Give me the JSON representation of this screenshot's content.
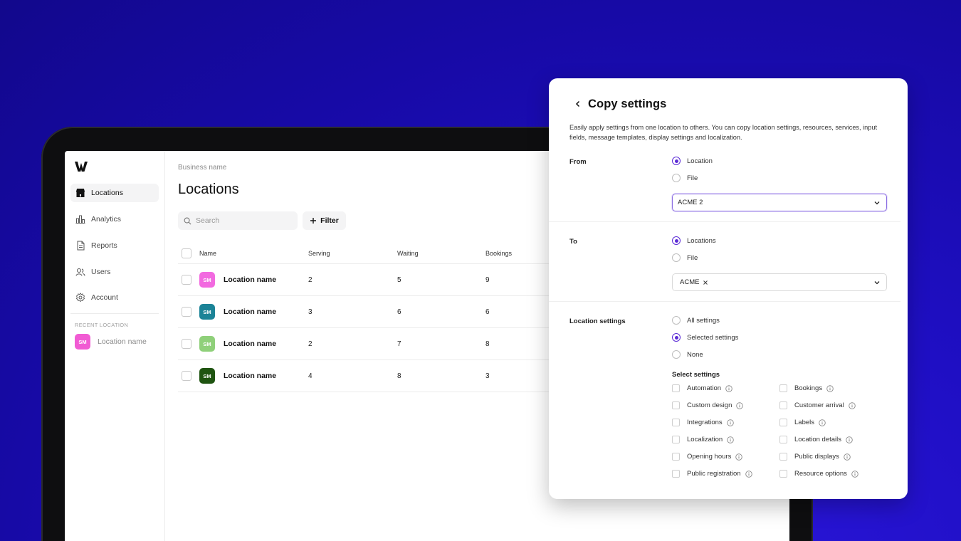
{
  "colors": {
    "accent": "#5b2bd6",
    "background": "#1a0cb3"
  },
  "sidebar": {
    "logo_icon": "logo-w-icon",
    "items": [
      {
        "label": "Locations",
        "icon": "store-icon",
        "active": true
      },
      {
        "label": "Analytics",
        "icon": "chart-icon",
        "active": false
      },
      {
        "label": "Reports",
        "icon": "document-icon",
        "active": false
      },
      {
        "label": "Users",
        "icon": "users-icon",
        "active": false
      },
      {
        "label": "Account",
        "icon": "gear-icon",
        "active": false
      }
    ],
    "recent_label": "RECENT LOCATION",
    "recent_item": {
      "initials": "SM",
      "label": "Location name",
      "color": "#f15bd3"
    }
  },
  "main": {
    "breadcrumb": "Business name",
    "title": "Locations",
    "search_placeholder": "Search",
    "filter_label": "Filter",
    "columns": [
      "Name",
      "Serving",
      "Waiting",
      "Bookings"
    ],
    "rows": [
      {
        "initials": "SM",
        "color": "#f26ae0",
        "name": "Location name",
        "serving": "2",
        "waiting": "5",
        "bookings": "9"
      },
      {
        "initials": "SM",
        "color": "#1b8397",
        "name": "Location name",
        "serving": "3",
        "waiting": "6",
        "bookings": "6"
      },
      {
        "initials": "SM",
        "color": "#8fd07a",
        "name": "Location name",
        "serving": "2",
        "waiting": "7",
        "bookings": "8"
      },
      {
        "initials": "SM",
        "color": "#1f5411",
        "name": "Location name",
        "serving": "4",
        "waiting": "8",
        "bookings": "3"
      }
    ]
  },
  "panel": {
    "title": "Copy settings",
    "description": "Easily apply settings from one location to others. You can copy location settings, resources, services, input fields, message templates, display settings and localization.",
    "from": {
      "label": "From",
      "options": [
        "Location",
        "File"
      ],
      "selected": "Location",
      "select_value": "ACME 2"
    },
    "to": {
      "label": "To",
      "options": [
        "Locations",
        "File"
      ],
      "selected": "Locations",
      "chip": "ACME"
    },
    "location_settings": {
      "label": "Location settings",
      "options": [
        "All settings",
        "Selected settings",
        "None"
      ],
      "selected": "Selected settings"
    },
    "select_settings_label": "Select settings",
    "settings_left": [
      "Automation",
      "Custom design",
      "Integrations",
      "Localization",
      "Opening hours",
      "Public registration"
    ],
    "settings_right": [
      "Bookings",
      "Customer arrival",
      "Labels",
      "Location details",
      "Public displays",
      "Resource options"
    ]
  }
}
